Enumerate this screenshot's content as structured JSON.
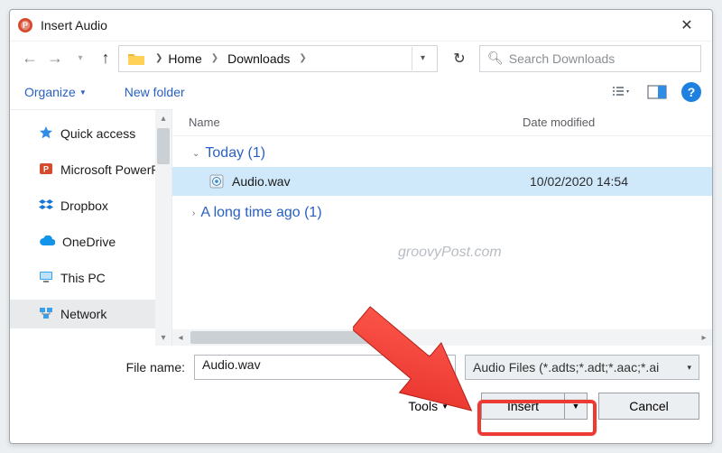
{
  "window": {
    "title": "Insert Audio"
  },
  "nav": {
    "crumb1": "Home",
    "crumb2": "Downloads",
    "search_placeholder": "Search Downloads"
  },
  "toolbar": {
    "organize": "Organize",
    "newfolder": "New folder"
  },
  "sidebar": {
    "items": [
      {
        "label": "Quick access"
      },
      {
        "label": "Microsoft PowerPo"
      },
      {
        "label": "Dropbox"
      },
      {
        "label": "OneDrive"
      },
      {
        "label": "This PC"
      },
      {
        "label": "Network"
      }
    ]
  },
  "columns": {
    "name": "Name",
    "modified": "Date modified"
  },
  "groups": {
    "g0": {
      "label": "Today (1)"
    },
    "g1": {
      "label": "A long time ago (1)"
    }
  },
  "files": {
    "f0": {
      "name": "Audio.wav",
      "modified": "10/02/2020 14:54"
    }
  },
  "footer": {
    "filename_label": "File name:",
    "filename_value": "Audio.wav",
    "filter_label": "Audio Files (*.adts;*.adt;*.aac;*.ai",
    "tools_label": "Tools",
    "insert_label": "Insert",
    "cancel_label": "Cancel"
  },
  "watermark": "groovyPost.com",
  "help": "?"
}
